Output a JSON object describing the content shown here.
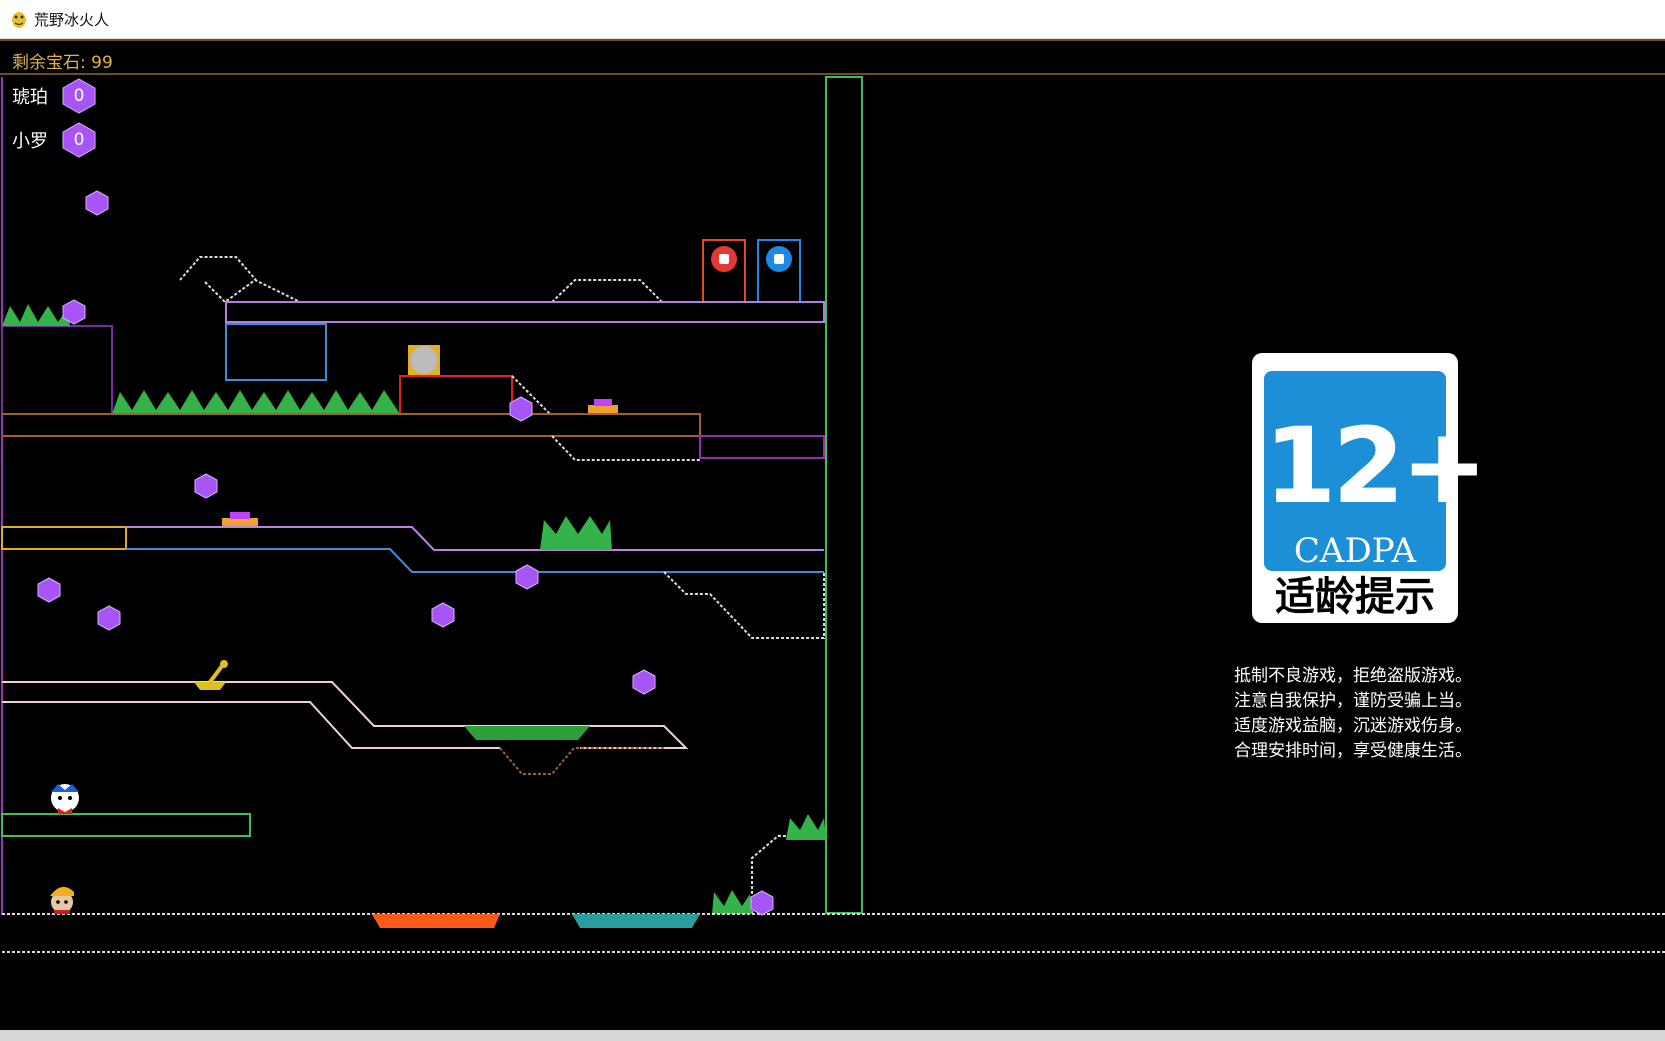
{
  "window": {
    "title": "荒野冰火人",
    "app_icon": "pygame-snake-icon"
  },
  "hud": {
    "gems_remaining": "剩余宝石: 99",
    "color": "#e0b04a"
  },
  "players": [
    {
      "name": "琥珀",
      "gems": "0"
    },
    {
      "name": "小罗",
      "gems": "0"
    }
  ],
  "age_rating": {
    "number": "12+",
    "org": "CADPA",
    "label": "适龄提示"
  },
  "health_notice": [
    "抵制不良游戏，拒绝盗版游戏。",
    "注意自我保护，谨防受骗上当。",
    "适度游戏益脑，沉迷游戏伤身。",
    "合理安排时间，享受健康生活。"
  ],
  "colors": {
    "gem": "#a855f7",
    "fire_door": "#e53935",
    "ice_door": "#1e88e5",
    "lava": "#ff5a1a",
    "water": "#2a9d9d",
    "acid": "#2e9e3a",
    "bush": "#33b34a",
    "button": "#c040ff"
  }
}
